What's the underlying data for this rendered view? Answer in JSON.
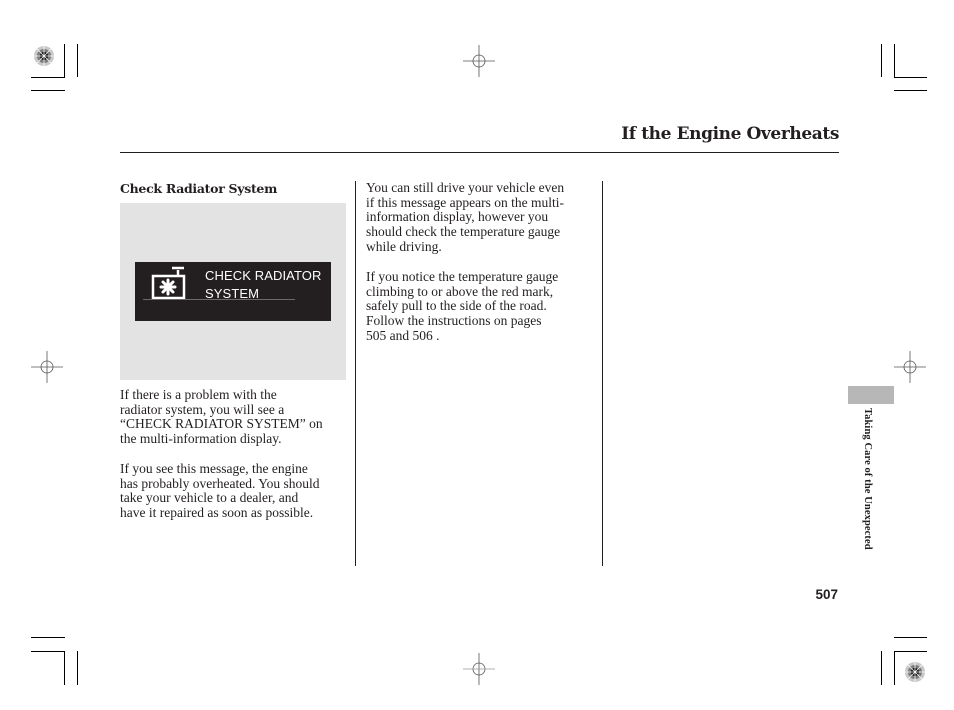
{
  "page": {
    "title": "If the Engine Overheats",
    "page_number": "507",
    "side_tab_label": "Taking Care of the Unexpected"
  },
  "left_column": {
    "heading": "Check Radiator System",
    "figure": {
      "icon": "radiator-warning-icon",
      "display_text": "CHECK RADIATOR\nSYSTEM"
    },
    "paragraphs": [
      "If there is a problem with the\nradiator system, you will see a\n“CHECK RADIATOR SYSTEM” on\nthe multi-information display.",
      "If you see this message, the engine\nhas probably overheated. You should\ntake your vehicle to a dealer, and\nhave it repaired as soon as possible."
    ]
  },
  "middle_column": {
    "paragraphs": [
      "You can still drive your vehicle even\nif this message appears on the multi-\ninformation display, however you\nshould check the temperature gauge\nwhile driving.",
      "If you notice the temperature gauge\nclimbing to or above the red mark,\nsafely pull to the side of the road.\nFollow the instructions on pages\n 505 and  506 ."
    ]
  }
}
